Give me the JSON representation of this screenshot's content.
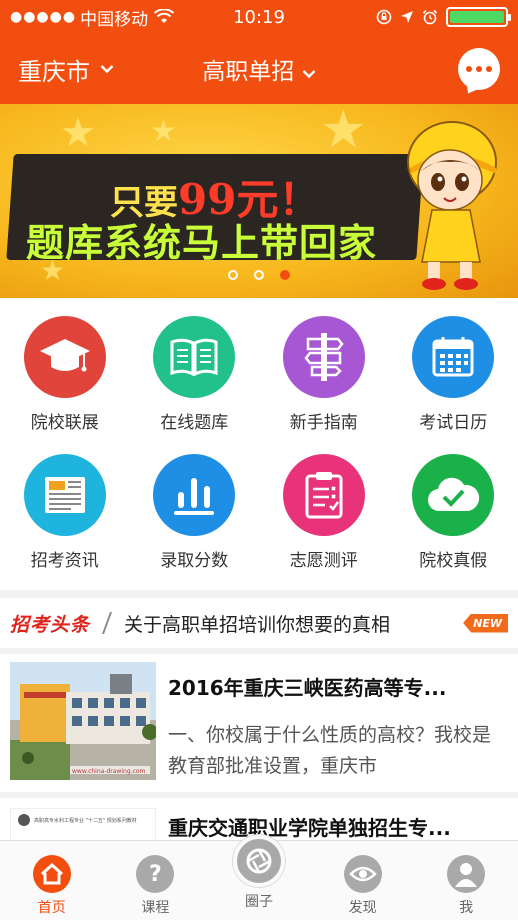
{
  "status_bar": {
    "carrier": "中国移动",
    "time": "10:19"
  },
  "header": {
    "city": "重庆市",
    "category": "高职单招"
  },
  "banner": {
    "line1_prefix": "只要",
    "line1_price": "99元！",
    "line2": "题库系统马上带回家",
    "page_count": 3,
    "active_page": 3
  },
  "grid": [
    {
      "label": "院校联展",
      "icon": "graduation-cap-icon",
      "color": "#e0443a"
    },
    {
      "label": "在线题库",
      "icon": "book-icon",
      "color": "#22c08a"
    },
    {
      "label": "新手指南",
      "icon": "signpost-icon",
      "color": "#a857d4"
    },
    {
      "label": "考试日历",
      "icon": "calendar-icon",
      "color": "#1f8fe6"
    },
    {
      "label": "招考资讯",
      "icon": "newspaper-icon",
      "color": "#1fb4dd"
    },
    {
      "label": "录取分数",
      "icon": "bar-chart-icon",
      "color": "#1f8fe6"
    },
    {
      "label": "志愿测评",
      "icon": "clipboard-icon",
      "color": "#e8337a"
    },
    {
      "label": "院校真假",
      "icon": "cloud-check-icon",
      "color": "#1ab04a"
    }
  ],
  "headline": {
    "tag": "招考头条",
    "text": "关于高职单招培训你想要的真相",
    "badge": "NEW"
  },
  "news": [
    {
      "title": "2016年重庆三峡医药高等专...",
      "summary": "一、你校属于什么性质的高校？我校是教育部批准设置，重庆市",
      "thumb_caption": "www.china-drawing.com"
    },
    {
      "title": "重庆交通职业学院单独招生专...",
      "thumb_caption": "高职高专水利工程专业 \"十二五\" 规划系列教材"
    }
  ],
  "tabbar": [
    {
      "label": "首页",
      "icon": "home-icon",
      "active": true
    },
    {
      "label": "课程",
      "icon": "question-icon",
      "active": false
    },
    {
      "label": "圈子",
      "icon": "camera-aperture-icon",
      "active": false
    },
    {
      "label": "发现",
      "icon": "eye-icon",
      "active": false
    },
    {
      "label": "我",
      "icon": "user-icon",
      "active": false
    }
  ],
  "colors": {
    "brand": "#f24e10",
    "headline_tag": "#e0241c",
    "new_badge": "#f26a1b"
  }
}
